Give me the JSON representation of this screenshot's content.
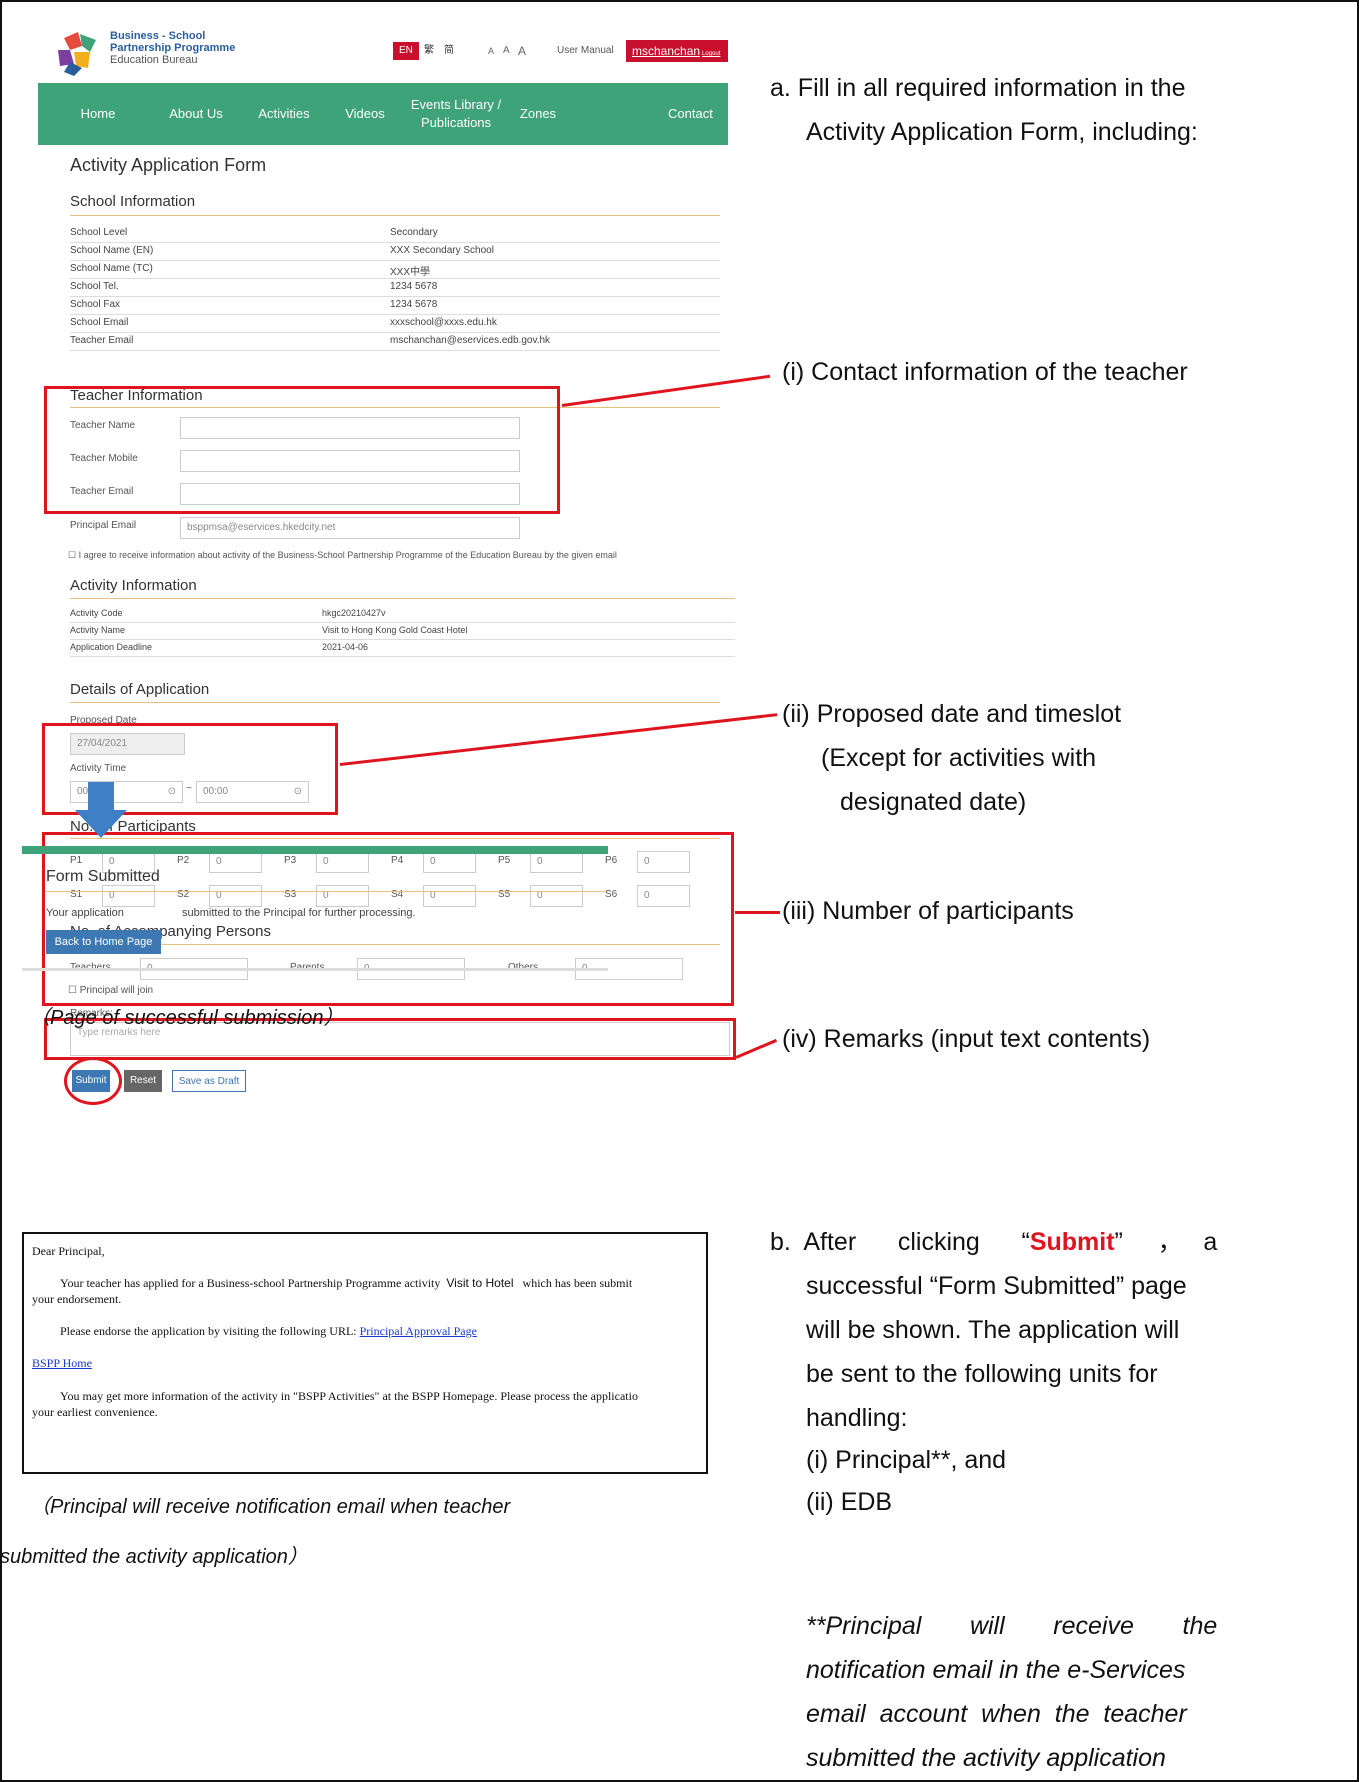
{
  "header": {
    "logo_line1": "Business - School",
    "logo_line2": "Partnership Programme",
    "logo_line3": "Education Bureau",
    "lang_en": "EN",
    "lang_trad": "繁",
    "lang_simp": "简",
    "font_sizes": [
      "A",
      "A",
      "A"
    ],
    "user_manual": "User Manual",
    "username": "mschanchan",
    "logout": "Logout"
  },
  "nav": {
    "items": [
      "Home",
      "About Us",
      "Activities",
      "Videos",
      "Events Library / Publications",
      "Zones",
      "Contact"
    ]
  },
  "form": {
    "title": "Activity Application Form",
    "school_info": {
      "heading": "School Information",
      "rows": [
        {
          "label": "School Level",
          "value": "Secondary"
        },
        {
          "label": "School Name (EN)",
          "value": "XXX Secondary School"
        },
        {
          "label": "School Name (TC)",
          "value": "XXX中學"
        },
        {
          "label": "School Tel.",
          "value": "1234 5678"
        },
        {
          "label": "School Fax",
          "value": "1234 5678"
        },
        {
          "label": "School Email",
          "value": "xxxschool@xxxs.edu.hk"
        },
        {
          "label": "Teacher Email",
          "value": "mschanchan@eservices.edb.gov.hk"
        }
      ]
    },
    "teacher_info": {
      "heading": "Teacher Information",
      "name_label": "Teacher Name",
      "mobile_label": "Teacher Mobile",
      "email_label": "Teacher Email",
      "principal_label": "Principal Email",
      "principal_value": "bsppmsa@eservices.hkedcity.net",
      "agree_text": "I agree to receive information about activity of the Business-School Partnership Programme of the Education Bureau by the given email"
    },
    "activity_info": {
      "heading": "Activity Information",
      "rows": [
        {
          "label": "Activity Code",
          "value": "hkgc20210427v"
        },
        {
          "label": "Activity Name",
          "value": "Visit to Hong Kong Gold Coast Hotel"
        },
        {
          "label": "Application Deadline",
          "value": "2021-04-06"
        }
      ]
    },
    "details": {
      "heading": "Details of Application",
      "date_label": "Proposed Date",
      "date_value": "27/04/2021",
      "time_label": "Activity Time",
      "time_from": "00:00",
      "time_to": "00:00",
      "time_sep": "~"
    },
    "participants": {
      "heading": "No. Of Participants",
      "row1": [
        {
          "label": "P1",
          "value": "0"
        },
        {
          "label": "P2",
          "value": "0"
        },
        {
          "label": "P3",
          "value": "0"
        },
        {
          "label": "P4",
          "value": "0"
        },
        {
          "label": "P5",
          "value": "0"
        },
        {
          "label": "P6",
          "value": "0"
        }
      ],
      "row2": [
        {
          "label": "S1",
          "value": "0"
        },
        {
          "label": "S2",
          "value": "0"
        },
        {
          "label": "S3",
          "value": "0"
        },
        {
          "label": "S4",
          "value": "0"
        },
        {
          "label": "S5",
          "value": "0"
        },
        {
          "label": "S6",
          "value": "0"
        }
      ]
    },
    "accompanying": {
      "heading": "No. of Accompanying Persons",
      "teachers_label": "Teachers",
      "teachers_value": "0",
      "parents_label": "Parents",
      "parents_value": "0",
      "others_label": "Others",
      "others_value": "0",
      "principal_join": "Principal will join"
    },
    "remarks": {
      "label": "Remarks:",
      "placeholder": "Type remarks here"
    },
    "buttons": {
      "submit": "Submit",
      "reset": "Reset",
      "draft": "Save as Draft"
    }
  },
  "submitted": {
    "title": "Form Submitted",
    "text_a": "Your application",
    "text_b": "submitted to the Principal for further processing.",
    "back_button": "Back to Home Page",
    "caption": "（Page of successful submission）"
  },
  "email": {
    "greeting": "Dear Principal,",
    "line1": "Your teacher has applied for a Business-school Partnership Programme activity",
    "activity": "Visit to Hotel",
    "line1b": "which has been submit",
    "line2": "your endorsement.",
    "line3": "Please endorse the application by visiting the following URL:",
    "link1": "Principal Approval Page",
    "link2": "BSPP Home",
    "line4": "You may get more information of the activity in \"BSPP Activities\" at the BSPP Homepage. Please process the applicatio",
    "line5": "your earliest convenience.",
    "caption_1": "（Principal will receive notification email when teacher",
    "caption_2": "submitted the activity application）"
  },
  "instructions": {
    "a_line1": "a.  Fill in all required information in the",
    "a_line2": "Activity Application Form, including:",
    "i": "(i) Contact information of the teacher",
    "ii_1": "(ii) Proposed date and timeslot",
    "ii_2": "(Except for activities with",
    "ii_3": "designated date)",
    "iii": "(iii) Number of participants",
    "iv": "(iv) Remarks (input text contents)",
    "b_1a": "b.  After      clicking      “",
    "b_submit": "Submit",
    "b_1b": "”     ，   a",
    "b_2": "successful “Form Submitted” page",
    "b_3": "will be shown. The application will",
    "b_4": "be sent to the following units for",
    "b_5": "handling:",
    "b_6": "(i) Principal**, and",
    "b_7": "(ii) EDB",
    "note_1": "**Principal       will       receive       the",
    "note_2": "notification email in the e-Services",
    "note_3": "email  account  when  the  teacher",
    "note_4": "submitted the activity application"
  }
}
